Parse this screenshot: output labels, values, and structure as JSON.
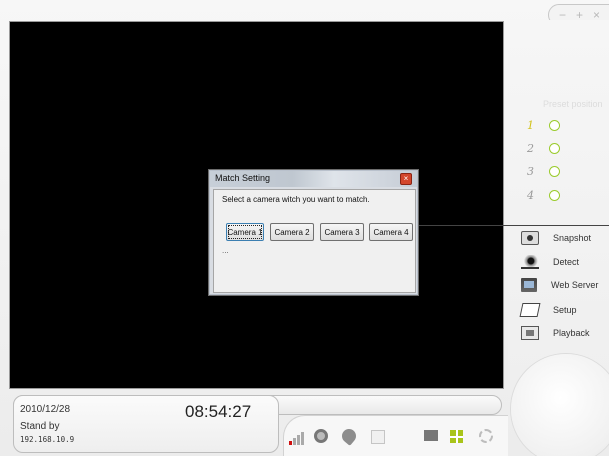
{
  "window_controls": {
    "minimize": "−",
    "maximize": "+",
    "close": "×"
  },
  "right_panel": {
    "faded_label": "Preset position",
    "cameras": [
      {
        "number": "1",
        "active": true
      },
      {
        "number": "2",
        "active": false
      },
      {
        "number": "3",
        "active": false
      },
      {
        "number": "4",
        "active": false
      }
    ],
    "menu": [
      {
        "label": "Snapshot",
        "icon": "camera-icon"
      },
      {
        "label": "Detect",
        "icon": "eye-icon"
      },
      {
        "label": "Web Server",
        "icon": "monitor-icon"
      },
      {
        "label": "Setup",
        "icon": "setup-icon"
      },
      {
        "label": "Playback",
        "icon": "playback-icon"
      }
    ]
  },
  "status": {
    "date": "2010/12/28",
    "time": "08:54:27",
    "state": "Stand by",
    "ip": "192.168.10.9"
  },
  "toolbar": {
    "icons": [
      "signal-strength-icon",
      "ptz-icon",
      "microphone-icon",
      "window-icon",
      "single-view-icon",
      "quad-view-icon",
      "refresh-icon"
    ],
    "signal_color": "#d01010",
    "quad_color": "#a9c41a"
  },
  "dialog": {
    "title": "Match Setting",
    "close": "×",
    "prompt": "Select a camera witch you want to match.",
    "buttons": [
      "Camera 1",
      "Camera 2",
      "Camera 3",
      "Camera 4"
    ],
    "focused_button": "Camera 1",
    "ellipsis": "..."
  }
}
